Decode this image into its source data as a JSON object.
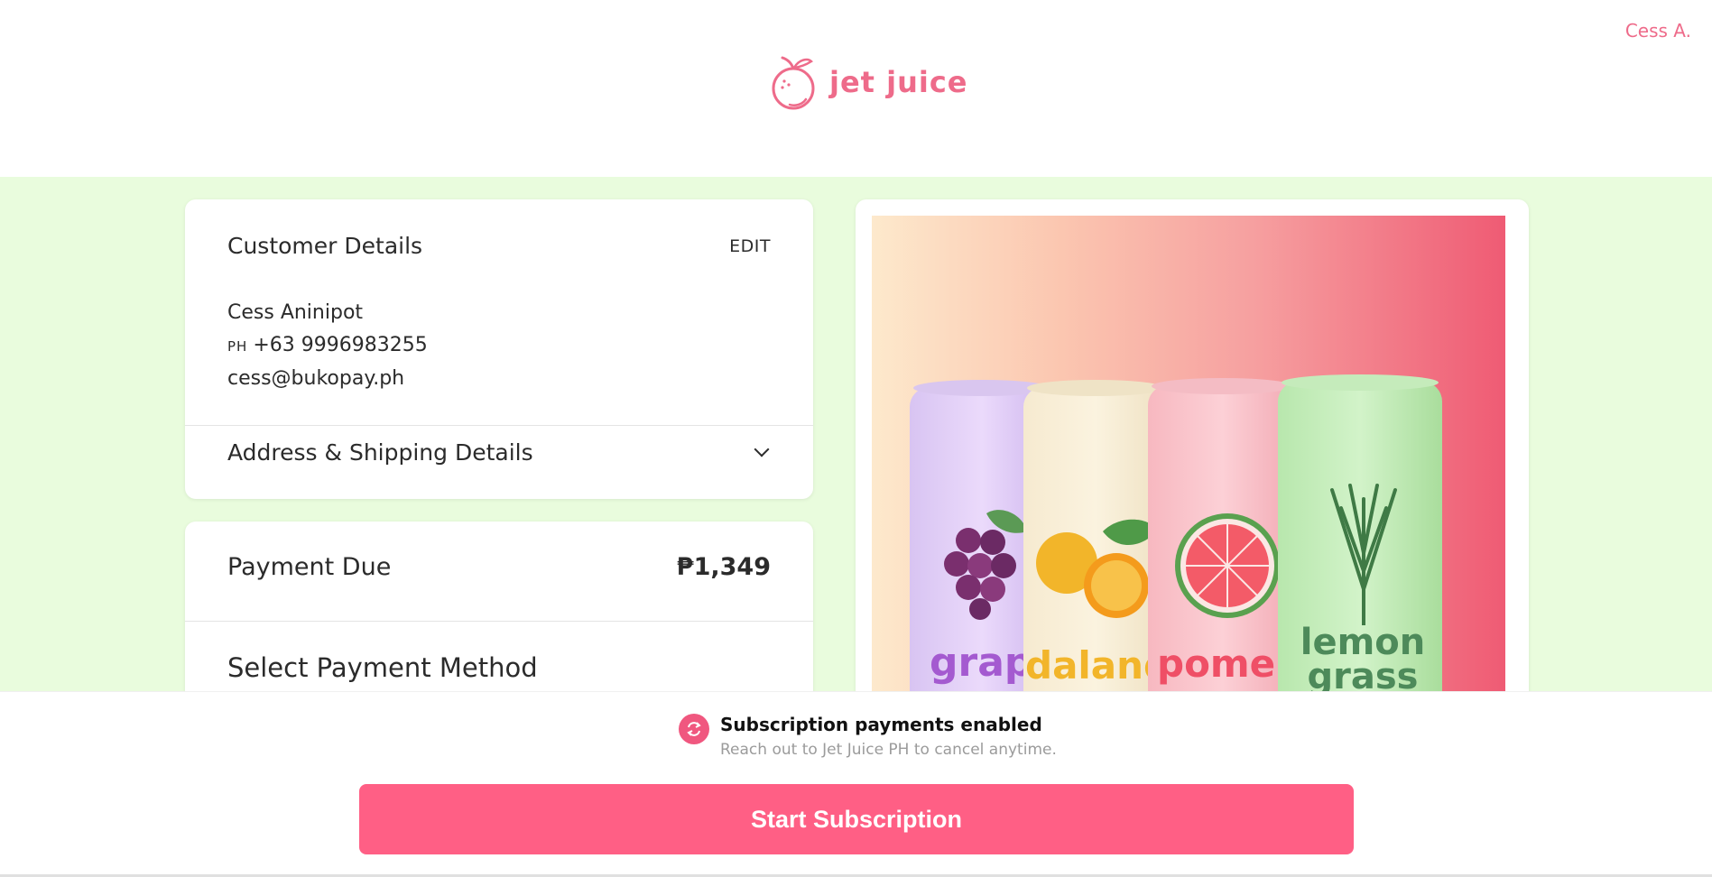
{
  "header": {
    "brand": "jet juice",
    "user_name": "Cess A."
  },
  "customer": {
    "title": "Customer Details",
    "edit_label": "EDIT",
    "name": "Cess Aninipot",
    "phone_country": "PH",
    "phone": "+63 9996983255",
    "email": "cess@bukopay.ph"
  },
  "address": {
    "title": "Address & Shipping Details"
  },
  "payment": {
    "due_label": "Payment Due",
    "amount": "₱1,349",
    "select_label": "Select Payment Method"
  },
  "product": {
    "cans": [
      "grap",
      "dalandan",
      "pomelo",
      "lemon grass"
    ]
  },
  "subscription": {
    "title": "Subscription payments enabled",
    "description": "Reach out to Jet Juice PH to cancel anytime.",
    "button_label": "Start Subscription"
  },
  "colors": {
    "brand_pink": "#ee6b8a",
    "button_pink": "#ff5f85",
    "bg_green": "#e9fcdd"
  }
}
